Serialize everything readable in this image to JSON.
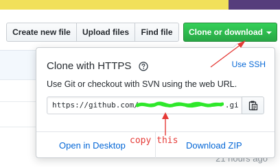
{
  "toolbar": {
    "create_new_file": "Create new file",
    "upload_files": "Upload files",
    "find_file": "Find file",
    "clone_or_download": "Clone or download"
  },
  "clone_popup": {
    "title": "Clone with HTTPS",
    "use_ssh": "Use SSH",
    "description": "Use Git or checkout with SVN using the web URL.",
    "url_prefix": "https://github.com/",
    "url_suffix": ".git",
    "open_in_desktop": "Open in Desktop",
    "download_zip": "Download ZIP",
    "help_icon": "question-circle-icon",
    "copy_icon": "clipboard-icon"
  },
  "background": {
    "timestamp": "21 hours ago"
  },
  "annotation": {
    "note": "copy this",
    "color": "#e53935",
    "scribble_color": "#2ee82a"
  },
  "colors": {
    "accent_link": "#0366d6",
    "clone_button": "#28a745",
    "lang_bar_primary": "#f1e05a",
    "lang_bar_secondary": "#563d7c"
  }
}
